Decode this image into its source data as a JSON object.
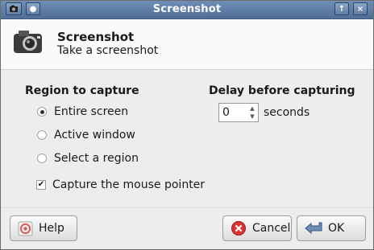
{
  "titlebar": {
    "title": "Screenshot"
  },
  "header": {
    "title": "Screenshot",
    "subtitle": "Take a screenshot"
  },
  "region": {
    "label": "Region to capture",
    "options": [
      {
        "label": "Entire screen",
        "selected": true
      },
      {
        "label": "Active window",
        "selected": false
      },
      {
        "label": "Select a region",
        "selected": false
      }
    ],
    "capture_pointer_label": "Capture the mouse pointer",
    "capture_pointer_checked": true
  },
  "delay": {
    "label": "Delay before capturing",
    "value": "0",
    "unit": "seconds"
  },
  "buttons": {
    "help": "Help",
    "cancel": "Cancel",
    "ok": "OK"
  },
  "icons": {
    "window_menu": "camera-icon",
    "pin": "pin-icon",
    "maximize": "maximize-icon",
    "close": "close-icon",
    "header": "camera-icon",
    "help": "help-icon",
    "cancel": "cancel-icon",
    "ok": "ok-icon"
  },
  "colors": {
    "titlebar": "#5e7ea7",
    "cancel_icon": "#d83434"
  }
}
